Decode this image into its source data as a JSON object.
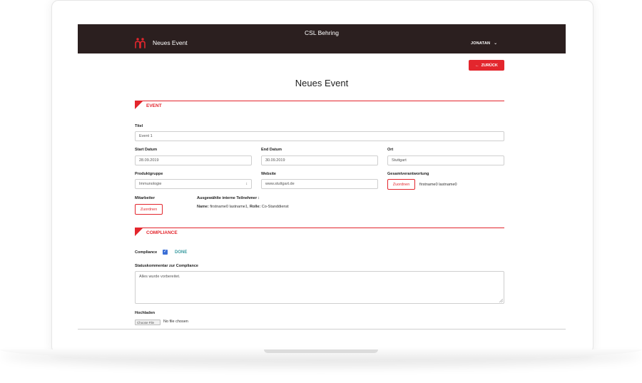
{
  "header": {
    "brand": "CSL Behring",
    "app_name": "Neues Event",
    "user": "JONATAN"
  },
  "toolbar": {
    "back_label": "ZURÜCK"
  },
  "page": {
    "title": "Neues Event"
  },
  "event_section": {
    "heading": "EVENT",
    "title_label": "Titel",
    "title_value": "Event 1",
    "start_label": "Start Datum",
    "start_value": "28.09.2019",
    "end_label": "End Datum",
    "end_value": "30.09.2019",
    "place_label": "Ort",
    "place_value": "Stuttgart",
    "product_label": "Produktgruppe",
    "product_value": "Immunologie",
    "website_label": "Website",
    "website_value": "www.stuttgart.de",
    "responsible_label": "Gesamtverantwortung",
    "responsible_button": "Zuordnen",
    "responsible_value": "firstname0 lastname0",
    "staff_label": "Mitarbeiter",
    "staff_button": "Zuordnen",
    "participants_label": "Ausgewählte interne Teilnehmer :",
    "participant_name_key": "Name:",
    "participant_name_value": "firstname0 lastname1,",
    "participant_role_key": "Rolle:",
    "participant_role_value": "Co-Standdienst"
  },
  "compliance_section": {
    "heading": "COMPLIANCE",
    "compliance_label": "Compliance",
    "checked": true,
    "status": "DONE",
    "comment_label": "Statuskommentar zur Compliance",
    "comment_value": "Alles wurde vorbereitet.",
    "upload_label": "Hochladen",
    "file_button": "Choose File",
    "file_status": "No file chosen"
  },
  "colors": {
    "accent": "#e3262d",
    "header_bg": "#2b1f1f",
    "done": "#3a9ba0",
    "checkbox": "#3b6fd6"
  }
}
